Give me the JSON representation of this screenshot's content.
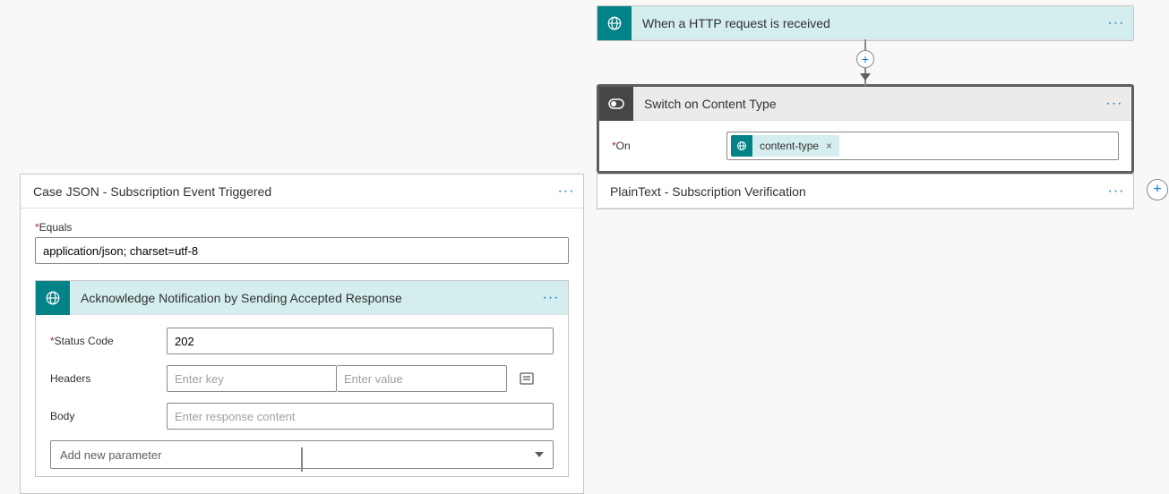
{
  "trigger": {
    "title": "When a HTTP request is received"
  },
  "switch": {
    "title": "Switch on Content Type",
    "on_label": "On",
    "pill_text": "content-type"
  },
  "case_json": {
    "title": "Case JSON - Subscription Event Triggered",
    "equals_label": "Equals",
    "equals_value": "application/json; charset=utf-8"
  },
  "ack": {
    "title": "Acknowledge Notification by Sending Accepted Response",
    "status_label": "Status Code",
    "status_value": "202",
    "headers_label": "Headers",
    "key_placeholder": "Enter key",
    "value_placeholder": "Enter value",
    "body_label": "Body",
    "body_placeholder": "Enter response content",
    "add_param": "Add new parameter"
  },
  "plaintext": {
    "title": "PlainText - Subscription Verification"
  }
}
